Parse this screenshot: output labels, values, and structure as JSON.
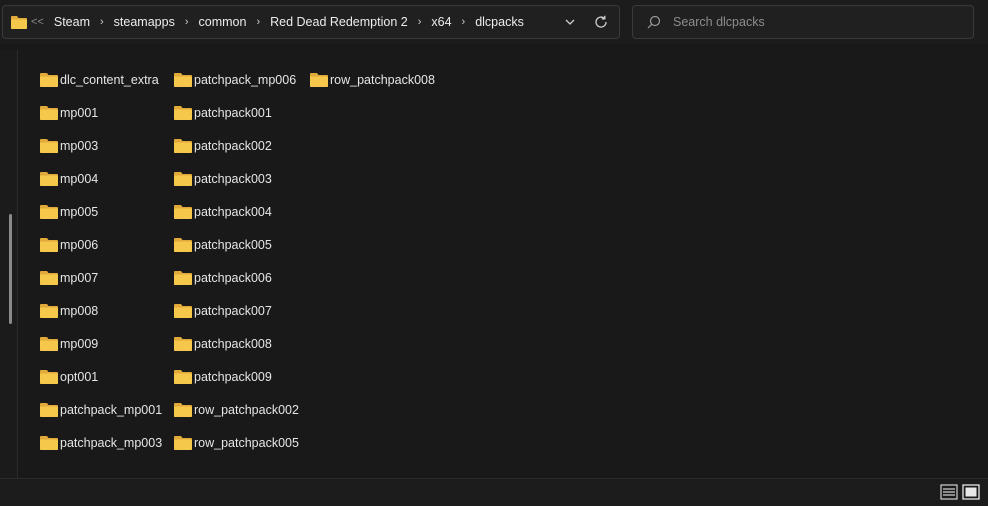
{
  "address_bar": {
    "overflow": "<<",
    "breadcrumbs": [
      "Steam",
      "steamapps",
      "common",
      "Red Dead Redemption 2",
      "x64",
      "dlcpacks"
    ]
  },
  "search": {
    "placeholder": "Search dlcpacks"
  },
  "files": [
    "dlc_content_extra",
    "mp001",
    "mp003",
    "mp004",
    "mp005",
    "mp006",
    "mp007",
    "mp008",
    "mp009",
    "opt001",
    "patchpack_mp001",
    "patchpack_mp003",
    "patchpack_mp006",
    "patchpack001",
    "patchpack002",
    "patchpack003",
    "patchpack004",
    "patchpack005",
    "patchpack006",
    "patchpack007",
    "patchpack008",
    "patchpack009",
    "row_patchpack002",
    "row_patchpack005",
    "row_patchpack008"
  ],
  "colors": {
    "folder": "#f5c84c",
    "folder_tab": "#e0a93a"
  }
}
